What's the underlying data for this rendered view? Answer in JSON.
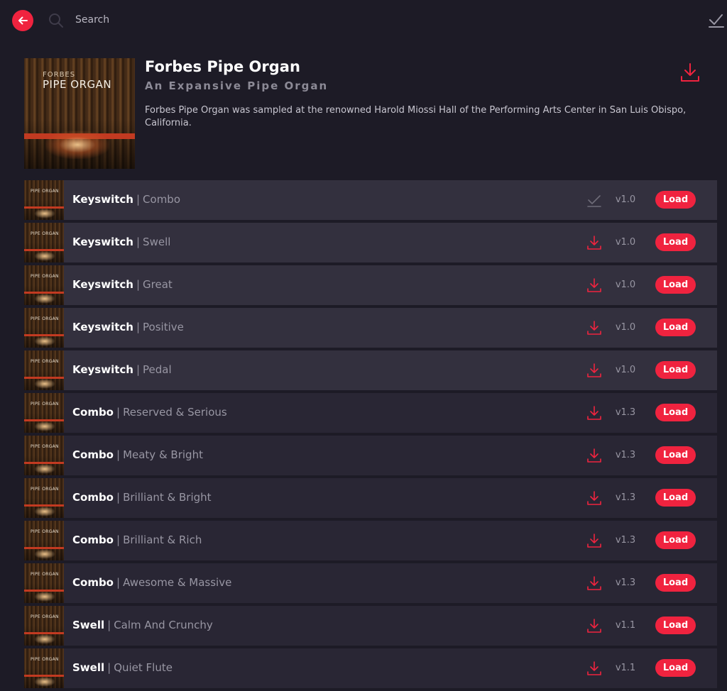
{
  "colors": {
    "accent": "#f0233f",
    "background": "#1d1b26",
    "row": "#292634",
    "row_alt": "#33303e"
  },
  "topbar": {
    "search_placeholder": "Search"
  },
  "product": {
    "cover_small": "FORBES",
    "cover_large": "PIPE ORGAN",
    "title": "Forbes Pipe Organ",
    "subtitle": "An Expansive Pipe Organ",
    "description": "Forbes Pipe Organ was sampled at the renowned Harold Miossi Hall of the Performing Arts Center in San Luis Obispo, California."
  },
  "thumb_label": "PIPE ORGAN",
  "presets": [
    {
      "category": "Keyswitch",
      "separator": "|",
      "name": "Combo",
      "version": "v1.0",
      "status": "installed",
      "load_label": "Load"
    },
    {
      "category": "Keyswitch",
      "separator": "|",
      "name": "Swell",
      "version": "v1.0",
      "status": "download",
      "load_label": "Load"
    },
    {
      "category": "Keyswitch",
      "separator": "|",
      "name": "Great",
      "version": "v1.0",
      "status": "download",
      "load_label": "Load"
    },
    {
      "category": "Keyswitch",
      "separator": "|",
      "name": "Positive",
      "version": "v1.0",
      "status": "download",
      "load_label": "Load"
    },
    {
      "category": "Keyswitch",
      "separator": "|",
      "name": "Pedal",
      "version": "v1.0",
      "status": "download",
      "load_label": "Load"
    },
    {
      "category": "Combo",
      "separator": "|",
      "name": "Reserved & Serious",
      "version": "v1.3",
      "status": "download",
      "load_label": "Load"
    },
    {
      "category": "Combo",
      "separator": "|",
      "name": "Meaty & Bright",
      "version": "v1.3",
      "status": "download",
      "load_label": "Load"
    },
    {
      "category": "Combo",
      "separator": "|",
      "name": "Brilliant & Bright",
      "version": "v1.3",
      "status": "download",
      "load_label": "Load"
    },
    {
      "category": "Combo",
      "separator": "|",
      "name": "Brilliant & Rich",
      "version": "v1.3",
      "status": "download",
      "load_label": "Load"
    },
    {
      "category": "Combo",
      "separator": "|",
      "name": "Awesome & Massive",
      "version": "v1.3",
      "status": "download",
      "load_label": "Load"
    },
    {
      "category": "Swell",
      "separator": "|",
      "name": "Calm And Crunchy",
      "version": "v1.1",
      "status": "download",
      "load_label": "Load"
    },
    {
      "category": "Swell",
      "separator": "|",
      "name": "Quiet Flute",
      "version": "v1.1",
      "status": "download",
      "load_label": "Load"
    }
  ]
}
